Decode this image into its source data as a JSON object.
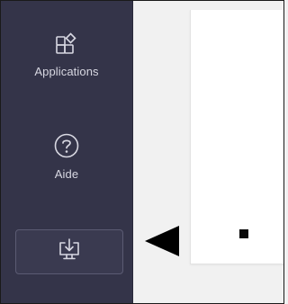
{
  "sidebar": {
    "items": [
      {
        "label": "Applications",
        "icon": "applications-grid-icon"
      },
      {
        "label": "Aide",
        "icon": "help-circle-icon"
      }
    ],
    "download_button": {
      "icon": "download-to-computer-icon"
    }
  },
  "colors": {
    "sidebar_bg": "#343449",
    "sidebar_text": "#d8d8e2",
    "panel_bg": "#ffffff",
    "page_bg": "#f1f1f1"
  }
}
